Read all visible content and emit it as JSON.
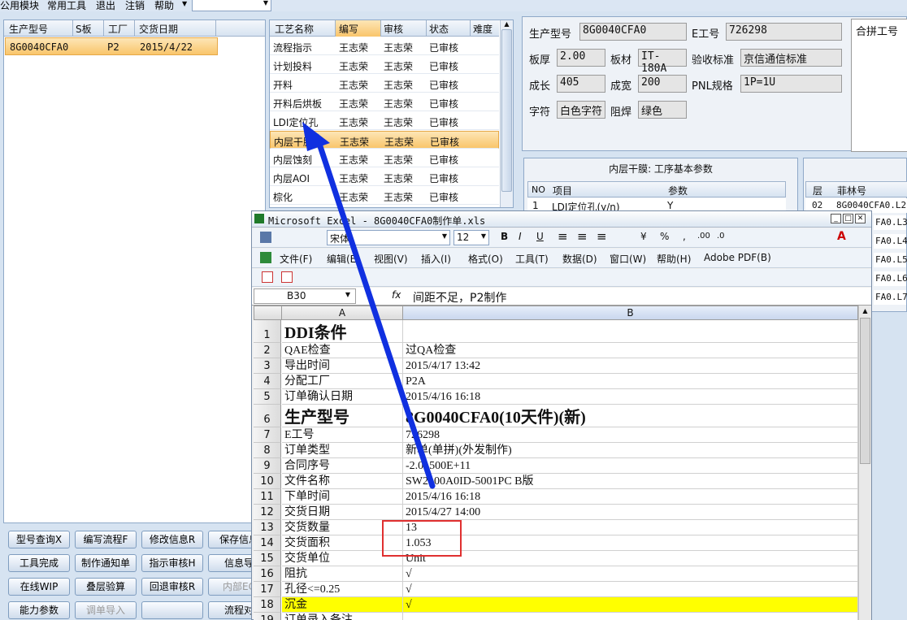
{
  "menu": [
    "公用模块",
    "常用工具",
    "退出",
    "注销",
    "帮助"
  ],
  "left_table": {
    "headers": [
      "生产型号",
      "S板",
      "工厂",
      "交货日期"
    ],
    "row": [
      "8G0040CFA0",
      "",
      "P2",
      "2015/4/22"
    ]
  },
  "process_table": {
    "headers": [
      "工艺名称",
      "编写",
      "审核",
      "状态",
      "难度"
    ],
    "rows": [
      [
        "流程指示",
        "王志荣",
        "王志荣",
        "已审核"
      ],
      [
        "计划投料",
        "王志荣",
        "王志荣",
        "已审核"
      ],
      [
        "开料",
        "王志荣",
        "王志荣",
        "已审核"
      ],
      [
        "开料后烘板",
        "王志荣",
        "王志荣",
        "已审核"
      ],
      [
        "LDI定位孔",
        "王志荣",
        "王志荣",
        "已审核"
      ],
      [
        "内层干膜",
        "王志荣",
        "王志荣",
        "已审核"
      ],
      [
        "内层蚀刻",
        "王志荣",
        "王志荣",
        "已审核"
      ],
      [
        "内层AOI",
        "王志荣",
        "王志荣",
        "已审核"
      ],
      [
        "棕化",
        "王志荣",
        "王志荣",
        "已审核"
      ]
    ]
  },
  "buttons": [
    [
      "型号查询X",
      "编写流程F",
      "修改信息R",
      "保存信息"
    ],
    [
      "工具完成",
      "制作通知单",
      "指示审核H",
      "信息导"
    ],
    [
      "在线WIP",
      "叠层验算",
      "回退审核R",
      "内部EC"
    ],
    [
      "能力参数",
      "调单导入",
      "",
      "流程对"
    ]
  ],
  "info": {
    "labels": {
      "model": "生产型号",
      "eno": "E工号",
      "merge": "合拼工号",
      "thick": "板厚",
      "mat": "板材",
      "std": "验收标准",
      "len": "成长",
      "wid": "成宽",
      "pnl": "PNL规格",
      "char": "字符",
      "mask": "阻焊"
    },
    "values": {
      "model": "8G0040CFA0",
      "eno": "726298",
      "thick": "2.00",
      "mat": "IT-180A",
      "std": "京信通信标准",
      "len": "405",
      "wid": "200",
      "pnl": "1P=1U",
      "char": "白色字符",
      "mask": "绿色"
    }
  },
  "param_panel": {
    "title": "内层干膜: 工序基本参数",
    "headers": [
      "NO",
      "项目",
      "参数"
    ],
    "row": [
      "1",
      "LDI定位孔(y/n)",
      "Y"
    ]
  },
  "right_panel": {
    "headers": [
      "层",
      "菲林号"
    ],
    "rows": [
      "02",
      "8G0040CFA0.L2",
      "FA0.L3",
      "FA0.L4",
      "FA0.L5",
      "FA0.L6",
      "FA0.L7"
    ]
  },
  "excel": {
    "title": "Microsoft Excel - 8G0040CFA0制作单.xls",
    "font": "宋体",
    "size": "12",
    "menu": [
      "文件(F)",
      "编辑(E)",
      "视图(V)",
      "插入(I)",
      "格式(O)",
      "工具(T)",
      "数据(D)",
      "窗口(W)",
      "帮助(H)",
      "Adobe PDF(B)"
    ],
    "cellref": "B30",
    "formula": "间距不足，P2制作",
    "cols": [
      "A",
      "B"
    ],
    "rows": [
      [
        "1",
        "DDI条件",
        ""
      ],
      [
        "2",
        "QAE检查",
        "过QA检查"
      ],
      [
        "3",
        "导出时间",
        "2015/4/17 13:42"
      ],
      [
        "4",
        "分配工厂",
        "P2A"
      ],
      [
        "5",
        "订单确认日期",
        "2015/4/16 16:18"
      ],
      [
        "6",
        "生产型号",
        "8G0040CFA0(10天件)(新)"
      ],
      [
        "7",
        "E工号",
        "726298"
      ],
      [
        "8",
        "订单类型",
        "新单(单拼)(外发制作)"
      ],
      [
        "9",
        "合同序号",
        "-2.01500E+11"
      ],
      [
        "10",
        "文件名称",
        "SW2100A0ID-5001PC B版"
      ],
      [
        "11",
        "下单时间",
        "2015/4/16 16:18"
      ],
      [
        "12",
        "交货日期",
        "2015/4/27 14:00"
      ],
      [
        "13",
        "交货数量",
        "13"
      ],
      [
        "14",
        "交货面积",
        "1.053"
      ],
      [
        "15",
        "交货单位",
        "Unit"
      ],
      [
        "16",
        "阻抗",
        "√"
      ],
      [
        "17",
        "孔径<=0.25",
        "√"
      ],
      [
        "18",
        "沉金",
        "√"
      ],
      [
        "19",
        "订单录入备注",
        ""
      ]
    ]
  },
  "colors": {
    "accent": "#f9c56b",
    "highlight": "#ffff00",
    "arrow": "#1030e0",
    "box": "#e03030"
  }
}
